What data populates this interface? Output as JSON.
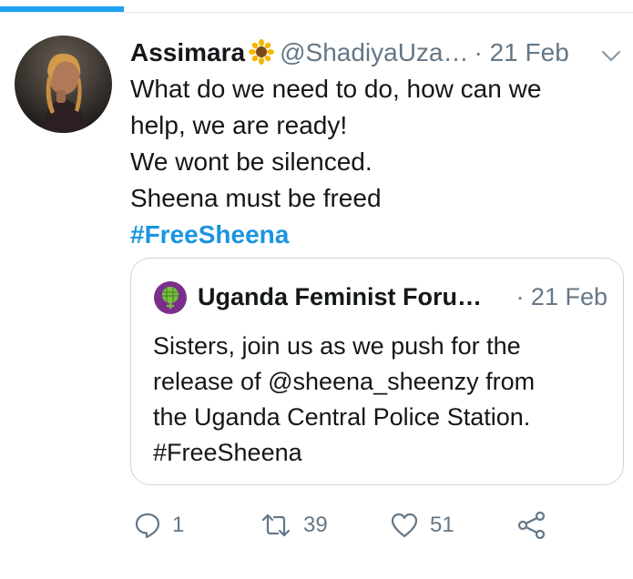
{
  "tweet": {
    "author_name": "Assimara",
    "name_emoji": "sunflower-emoji",
    "handle": "@ShadiyaUza…",
    "date": "· 21 Feb",
    "lines": [
      "What do we need to do, how can we",
      "help, we are ready!",
      "We wont be silenced.",
      "Sheena must be freed"
    ],
    "hashtag": "#FreeSheena"
  },
  "quoted_tweet": {
    "author_name": "Uganda Feminist Foru…",
    "date": "· 21 Feb",
    "lines": [
      "Sisters, join us as we push for the",
      "release of @sheena_sheenzy from",
      "the Uganda Central Police Station.",
      "#FreeSheena"
    ]
  },
  "actions": {
    "reply_count": "1",
    "retweet_count": "39",
    "like_count": "51"
  },
  "colors": {
    "accent": "#1da1f2",
    "hashtag": "#1b95e0",
    "secondary_text": "#657786",
    "border": "#ccd6dd"
  },
  "icons": [
    "chevron-down-icon",
    "reply-icon",
    "retweet-icon",
    "heart-icon",
    "share-icon"
  ]
}
